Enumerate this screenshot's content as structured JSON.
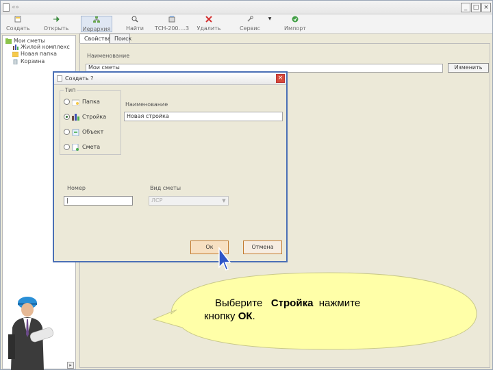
{
  "window": {
    "title": "«»",
    "controls": {
      "minimize": "_",
      "maximize": "□",
      "close": "×"
    }
  },
  "toolbar": {
    "items": [
      {
        "label": "Создать",
        "icon": "create-icon"
      },
      {
        "label": "Открыть",
        "icon": "open-icon"
      },
      {
        "label": "Иерархия",
        "icon": "hierarchy-icon"
      },
      {
        "label": "Найти",
        "icon": "find-icon"
      },
      {
        "label": "ТСН-200….3",
        "icon": "tsn-icon"
      },
      {
        "label": "Удалить",
        "icon": "delete-icon"
      },
      {
        "label": "Сервис",
        "icon": "service-icon"
      },
      {
        "label": "Импорт",
        "icon": "import-icon"
      }
    ]
  },
  "tree": {
    "items": [
      {
        "label": "Мои сметы",
        "icon": "folder-tree-icon"
      },
      {
        "label": "Жилой комплекс",
        "icon": "building-icon"
      },
      {
        "label": "Новая папка",
        "icon": "folder-icon"
      },
      {
        "label": "Корзина",
        "icon": "trash-icon"
      }
    ]
  },
  "tabs": [
    {
      "label": "Свойства",
      "active": true
    },
    {
      "label": "Поиск",
      "active": false
    }
  ],
  "properties": {
    "name_label": "Наименование",
    "name_value": "Мои сметы",
    "change_button": "Изменить"
  },
  "dialog": {
    "title": "Создать ?",
    "close": "×",
    "type_legend": "Тип",
    "types": [
      {
        "label": "Папка",
        "checked": false,
        "icon": "folder-icon"
      },
      {
        "label": "Стройка",
        "checked": true,
        "icon": "construction-icon"
      },
      {
        "label": "Объект",
        "checked": false,
        "icon": "object-icon"
      },
      {
        "label": "Смета",
        "checked": false,
        "icon": "estimate-icon"
      }
    ],
    "name_label": "Наименование",
    "name_value": "Новая стройка",
    "number_label": "Номер",
    "number_value": "|",
    "estimate_type_label": "Вид сметы",
    "estimate_type_value": "ЛСР",
    "ok_button": "Ок",
    "cancel_button": "Отмена"
  },
  "callout": {
    "line1_part1": "Выберите",
    "line1_bold": "Стройка",
    "line1_part2": "нажмите",
    "line2_part1": "кнопку",
    "line2_bold": "ОК",
    "line2_end": ".",
    "fill_color": "#FFFFA8"
  }
}
